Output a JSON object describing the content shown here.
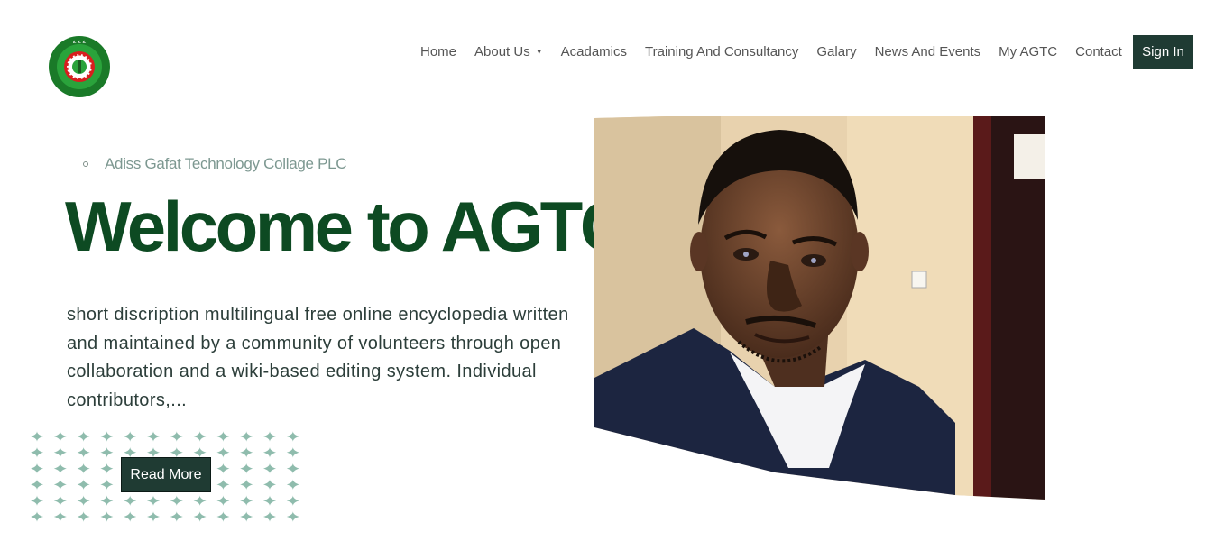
{
  "brand": {
    "logo_icon": "agtc-seal-logo",
    "logo_colors": {
      "ring": "#1a8a2e",
      "gear": "#e02020",
      "center": "#ffffff"
    }
  },
  "nav": {
    "items": [
      {
        "label": "Home"
      },
      {
        "label": "About Us",
        "has_dropdown": true,
        "dropdown_icon": "caret-down-icon"
      },
      {
        "label": "Acadamics"
      },
      {
        "label": "Training And Consultancy"
      },
      {
        "label": "Galary"
      },
      {
        "label": "News And Events"
      },
      {
        "label": "My AGTC"
      },
      {
        "label": "Contact"
      }
    ],
    "signin_label": "Sign In"
  },
  "hero": {
    "eyebrow": "Adiss Gafat Technology Collage PLC",
    "title": "Welcome to AGTC",
    "description": "short discription multilingual free online encyclopedia written and maintained by a community of volunteers through open collaboration and a wiki-based editing system. Individual contributors,...",
    "cta_label": "Read More",
    "photo_subject": "portrait-man-in-suit"
  },
  "colors": {
    "primary_dark": "#1f3b33",
    "title_green": "#0d4a22",
    "dot_pattern": "#8fbcad"
  }
}
